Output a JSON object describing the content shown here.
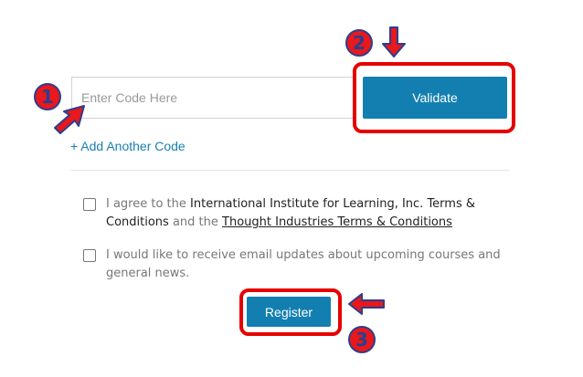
{
  "code_form": {
    "placeholder": "Enter Code Here",
    "value": "",
    "validate_label": "Validate",
    "add_code_label": "+ Add Another Code"
  },
  "terms": {
    "prefix": "I agree to the ",
    "org": "International Institute for Learning, Inc. Terms & Conditions",
    "middle": " and the ",
    "link": "Thought Industries Terms & Conditions",
    "checked": false
  },
  "newsletter": {
    "label": "I would like to receive email updates about upcoming courses and general news.",
    "checked": false
  },
  "register_label": "Register",
  "annotations": {
    "color": "#e8181d",
    "outline_color": "#2b3f8c",
    "step1": "1",
    "step2": "2",
    "step3": "3"
  },
  "colors": {
    "button": "#137fb0",
    "link": "#1a7fb0"
  }
}
